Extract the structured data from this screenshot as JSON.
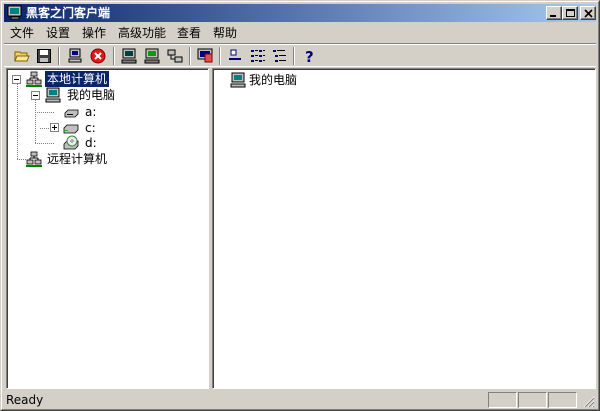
{
  "window": {
    "title": "黑客之门客户端"
  },
  "menu": {
    "items": [
      "文件",
      "设置",
      "操作",
      "高级功能",
      "查看",
      "帮助"
    ]
  },
  "toolbar": {
    "buttons": [
      "open-folder-icon",
      "save-disk-icon",
      "computer-connect-icon",
      "stop-icon",
      "monitor-icon",
      "monitor-green-icon",
      "network-icon",
      "screen-capture-icon",
      "large-icons-icon",
      "list-view-icon",
      "details-view-icon",
      "help-icon"
    ]
  },
  "tree": {
    "local": "本地计算机",
    "my_computer": "我的电脑",
    "drive_a": "a:",
    "drive_c": "c:",
    "drive_d": "d:",
    "remote": "远程计算机"
  },
  "content": {
    "items": [
      "我的电脑"
    ]
  },
  "status": {
    "text": "Ready"
  },
  "colors": {
    "title_start": "#0a246a",
    "title_end": "#a6caf0",
    "selection": "#0a246a",
    "stop_red": "#e01818",
    "chrome": "#d4d0c8"
  }
}
